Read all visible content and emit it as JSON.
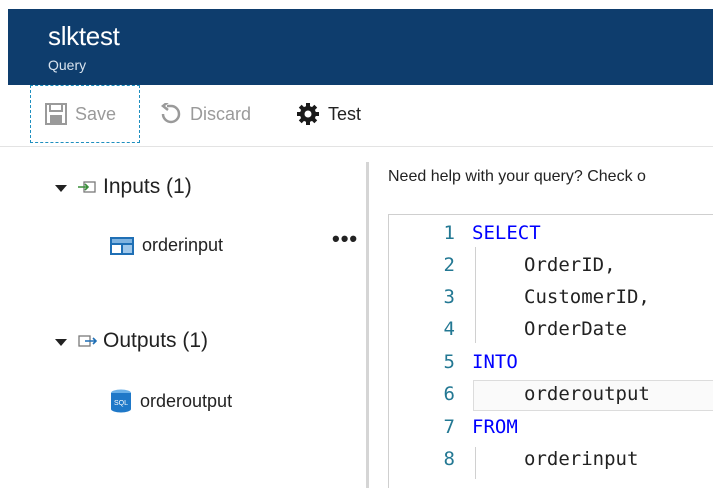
{
  "header": {
    "title": "slktest",
    "subtitle": "Query"
  },
  "toolbar": {
    "save_label": "Save",
    "discard_label": "Discard",
    "test_label": "Test"
  },
  "tree": {
    "inputs": {
      "label": "Inputs (1)",
      "items": [
        {
          "label": "orderinput"
        }
      ]
    },
    "outputs": {
      "label": "Outputs (1)",
      "items": [
        {
          "label": "orderoutput"
        }
      ]
    },
    "more_label": "•••"
  },
  "help_text": "Need help with your query? Check o",
  "editor": {
    "lines": [
      {
        "num": "1",
        "text": "SELECT",
        "kind": "keyword"
      },
      {
        "num": "2",
        "text": "OrderID,",
        "kind": "ident"
      },
      {
        "num": "3",
        "text": "CustomerID,",
        "kind": "ident"
      },
      {
        "num": "4",
        "text": "OrderDate",
        "kind": "ident"
      },
      {
        "num": "5",
        "text": "INTO",
        "kind": "keyword"
      },
      {
        "num": "6",
        "text": "orderoutput",
        "kind": "ident"
      },
      {
        "num": "7",
        "text": "FROM",
        "kind": "keyword"
      },
      {
        "num": "8",
        "text": "orderinput",
        "kind": "ident"
      }
    ]
  },
  "colors": {
    "header_bg": "#0e3d6d",
    "keyword": "#0000ff",
    "line_number": "#237893",
    "focus_border": "#1e8fbf"
  },
  "icons": {
    "save": "save-icon",
    "discard": "discard-icon",
    "test": "gear-icon",
    "inputs": "input-icon",
    "outputs": "output-icon",
    "input_item": "stream-input-icon",
    "output_item": "sql-database-icon"
  }
}
